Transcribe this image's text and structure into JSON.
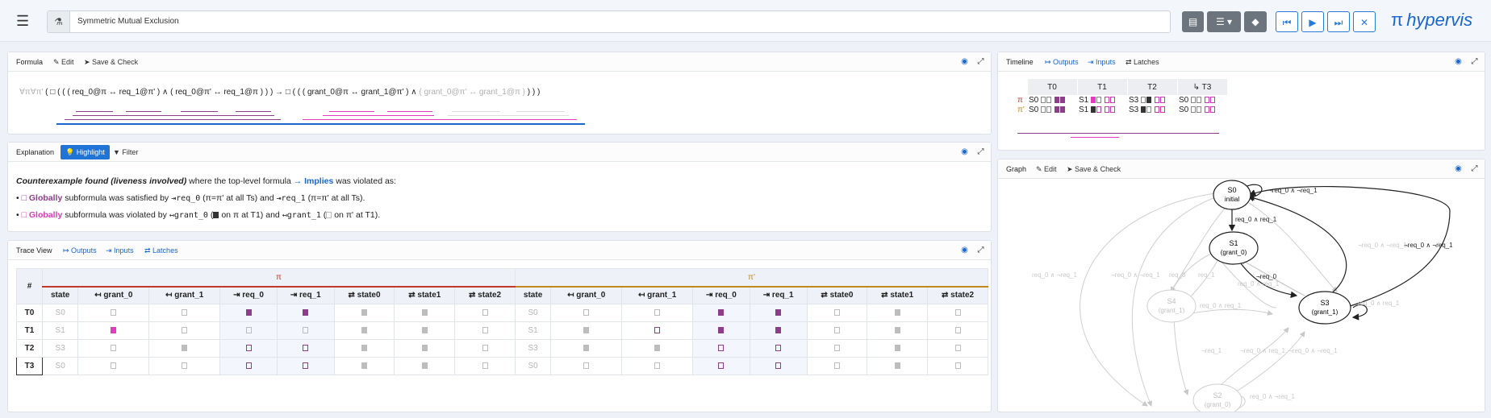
{
  "app": {
    "title_value": "Symmetric Mutual Exclusion",
    "brand_symbol": "π",
    "brand_name": "hypervis",
    "accent_color": "#1f74d6",
    "pi_color": "#c0392b",
    "pi_prime_color": "#c08a1c"
  },
  "formula_panel": {
    "title": "Formula",
    "edit_label": "Edit",
    "save_label": "Save & Check",
    "quantifiers": "∀π∀π'",
    "text_left": "( □ ( ( ( req_0@π ↔ req_1@π' ) ∧ ( req_0@π' ↔ req_1@π ) ) ) → □ ( ( ( grant_0@π ↔ grant_1@π' ) ∧",
    "text_dim": "( grant_0@π' ↔ grant_1@π )",
    "text_right": ") ) )"
  },
  "explanation_panel": {
    "title": "Explanation",
    "highlight_label": "Highlight",
    "filter_label": "Filter",
    "line1_bold": "Counterexample found (liveness involved)",
    "line1_rest": "where the top-level formula",
    "line1_op": "→ Implies",
    "line1_end": "was violated as:",
    "b1_op": "□ Globally",
    "b1_text": "subformula was satisfied by",
    "b1_var1": "req_0",
    "b1_par1": "(π=π' at all Ts)",
    "b1_and": "and",
    "b1_var2": "req_1",
    "b1_par2": "(π=π' at all Ts).",
    "b2_op": "□ Globally",
    "b2_text": "subformula was violated by",
    "b2_var1": "grant_0",
    "b2_par1": "on π at T1)",
    "b2_and": "and",
    "b2_var2": "grant_1",
    "b2_par2": "on π' at T1)."
  },
  "trace_panel": {
    "title": "Trace View",
    "outputs_label": "Outputs",
    "inputs_label": "Inputs",
    "latches_label": "Latches",
    "pi_label": "π",
    "pi_prime_label": "π'",
    "hash_label": "#",
    "columns": [
      "state",
      "grant_0",
      "grant_1",
      "req_0",
      "req_1",
      "state0",
      "state1",
      "state2"
    ],
    "rows": [
      {
        "t": "T0",
        "pi": [
          "S0",
          "e",
          "e",
          "f",
          "f",
          "g",
          "g",
          "e"
        ],
        "pp": [
          "S0",
          "e",
          "e",
          "f",
          "f",
          "e",
          "g",
          "e"
        ]
      },
      {
        "t": "T1",
        "pi": [
          "S1",
          "fp",
          "e",
          "e",
          "e",
          "g",
          "g",
          "e"
        ],
        "pp": [
          "S1",
          "g",
          "ep",
          "f",
          "f",
          "e",
          "g",
          "e"
        ]
      },
      {
        "t": "T2",
        "pi": [
          "S3",
          "e",
          "g",
          "ep",
          "ep",
          "g",
          "g",
          "e"
        ],
        "pp": [
          "S3",
          "g",
          "g",
          "ep",
          "ep",
          "e",
          "g",
          "e"
        ]
      },
      {
        "t": "T3",
        "pi": [
          "S0",
          "e",
          "e",
          "ep",
          "ep",
          "g",
          "g",
          "e"
        ],
        "pp": [
          "S0",
          "e",
          "e",
          "ep",
          "ep",
          "e",
          "g",
          "e"
        ]
      }
    ]
  },
  "timeline_panel": {
    "title": "Timeline",
    "outputs_label": "Outputs",
    "inputs_label": "Inputs",
    "latches_label": "Latches",
    "times": [
      "T0",
      "T1",
      "T2",
      "T3"
    ],
    "loop_arrow": "↳",
    "rows": [
      {
        "label": "π",
        "states": [
          "S0",
          "S1",
          "S3",
          "S0"
        ]
      },
      {
        "label": "π'",
        "states": [
          "S0",
          "S1",
          "S3",
          "S0"
        ]
      }
    ]
  },
  "graph_panel": {
    "title": "Graph",
    "edit_label": "Edit",
    "save_label": "Save & Check",
    "nodes": [
      {
        "id": "S0",
        "sub": "initial"
      },
      {
        "id": "S1",
        "sub": "(grant_0)"
      },
      {
        "id": "S3",
        "sub": "(grant_1)"
      },
      {
        "id": "S4",
        "sub": "(grant_1)"
      },
      {
        "id": "S2",
        "sub": "(grant_0)"
      }
    ],
    "edge_labels": {
      "s0_self": "¬req_0 ∧ ¬req_1",
      "s0_s1": "req_0 ∧ req_1",
      "s1_s3": "¬req_0",
      "s3_s0": "¬req_0 ∧ ¬req_1",
      "s3_self": "req_0 ∧ req_1",
      "s3_right": "¬req_0 ∧ ¬req_1",
      "left_long": "req_0 ∧ ¬req_1",
      "left_mid": "¬req_0 ∧ ¬req_1",
      "s4_a": "req_0",
      "s4_b": "req_1",
      "s1_s2a": "req_0 ∧ req_1",
      "s4_s3": "req_0 ∧ req_1",
      "s4_s2": "¬req_1",
      "s2_s3a": "¬req_0 ∧ req_1",
      "s2_s3b": "¬req_0 ∧ ¬req_1",
      "s2_self": "req_0 ∧ ¬req_1"
    }
  }
}
